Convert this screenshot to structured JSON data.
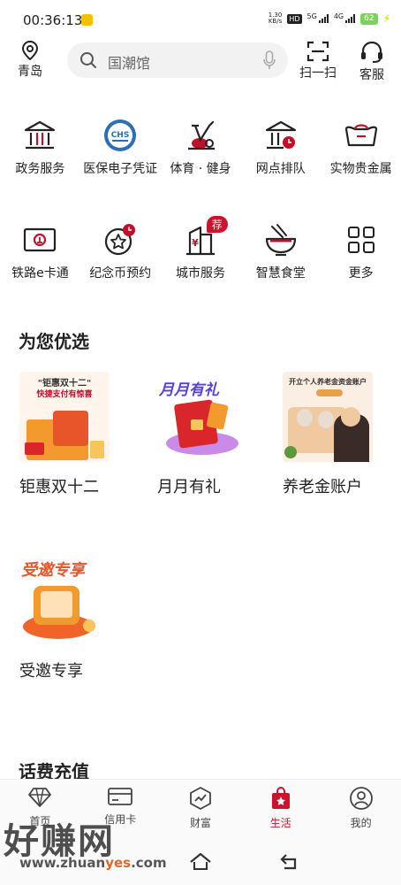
{
  "status_bar": {
    "time": "00:36:13",
    "net_speed": "1.30",
    "net_unit": "KB/s",
    "hd": "HD",
    "net1": "5G",
    "net2": "4G",
    "battery": "62"
  },
  "header": {
    "location": "青岛",
    "search_placeholder": "国潮馆",
    "scan_label": "扫一扫",
    "service_label": "客服"
  },
  "services_row1": [
    {
      "label": "政务服务",
      "icon": "government-icon"
    },
    {
      "label": "医保电子凭证",
      "icon": "medical-insurance-icon"
    },
    {
      "label": "体育 · 健身",
      "icon": "fitness-bike-icon"
    },
    {
      "label": "网点排队",
      "icon": "branch-queue-icon"
    },
    {
      "label": "实物贵金属",
      "icon": "gold-ingot-icon"
    }
  ],
  "services_row2": [
    {
      "label": "铁路e卡通",
      "icon": "railway-card-icon"
    },
    {
      "label": "纪念币预约",
      "icon": "coin-reservation-icon"
    },
    {
      "label": "城市服务",
      "icon": "city-service-icon",
      "badge": "荐"
    },
    {
      "label": "智慧食堂",
      "icon": "canteen-bowl-icon"
    },
    {
      "label": "更多",
      "icon": "more-grid-icon"
    }
  ],
  "recommend": {
    "title": "为您优选",
    "items": [
      {
        "caption": "钜惠双十二",
        "banner_line1": "\"钜惠双十二\"",
        "banner_line2": "快捷支付有惊喜"
      },
      {
        "caption": "月月有礼",
        "banner_line1": "月月有礼"
      },
      {
        "caption": "养老金账户",
        "banner_line1": "开立个人养老金资金账户"
      },
      {
        "caption": "受邀专享",
        "banner_line1": "受邀专享"
      }
    ]
  },
  "next_section": {
    "title": "话费充值"
  },
  "bottom_nav": [
    {
      "label": "首页",
      "icon": "diamond-icon"
    },
    {
      "label": "信用卡",
      "icon": "card-icon"
    },
    {
      "label": "财富",
      "icon": "wealth-icon"
    },
    {
      "label": "生活",
      "icon": "life-bag-icon",
      "active": true
    },
    {
      "label": "我的",
      "icon": "profile-icon"
    }
  ],
  "watermark": {
    "text": "好赚网",
    "url_prefix": "www.zhuan",
    "url_mid": "yes",
    "url_suffix": ".com"
  },
  "colors": {
    "accent": "#d0112b",
    "text": "#222222"
  }
}
